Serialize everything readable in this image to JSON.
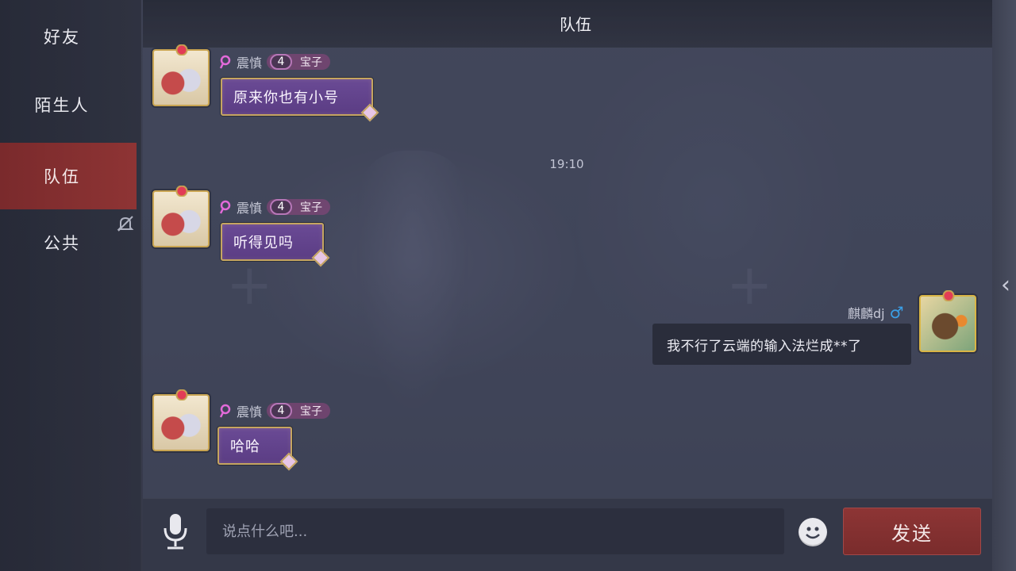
{
  "sidebar": {
    "tabs": [
      {
        "label": "好友"
      },
      {
        "label": "陌生人"
      },
      {
        "label": "队伍"
      },
      {
        "label": "公共"
      }
    ]
  },
  "header": {
    "title": "队伍"
  },
  "messages": [
    {
      "sender": "震慎",
      "level": "4",
      "tag": "宝子",
      "text": "原来你也有小号"
    },
    {
      "sender": "震慎",
      "level": "4",
      "tag": "宝子",
      "text": "听得见吗"
    },
    {
      "sender": "麒麟dj",
      "gender": "♂",
      "text": "我不行了云端的输入法烂成**了"
    },
    {
      "sender": "震慎",
      "level": "4",
      "tag": "宝子",
      "text": "哈哈"
    }
  ],
  "timestamp": "19:10",
  "input": {
    "placeholder": "说点什么吧..."
  },
  "send_label": "发送",
  "colors": {
    "active_tab": "#8e3434",
    "bubble_purple": "#6a4a95",
    "bubble_border_gold": "#c5a561",
    "send_button": "#8d3535",
    "male_icon": "#3aa0e8"
  }
}
